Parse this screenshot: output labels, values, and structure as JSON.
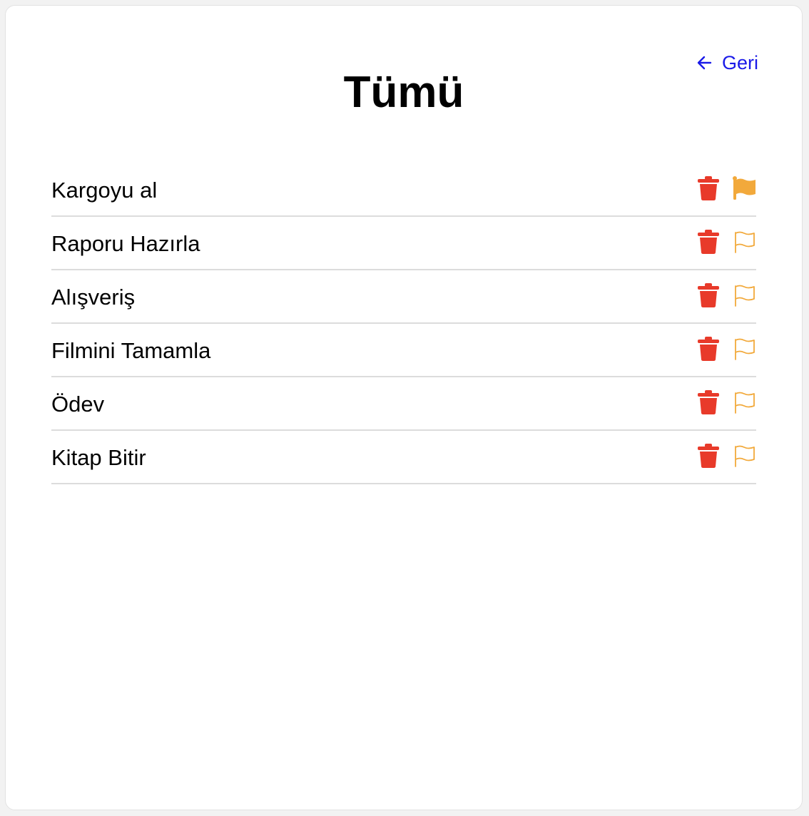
{
  "header": {
    "back_label": "Geri",
    "title": "Tümü"
  },
  "colors": {
    "link": "#1a1ae8",
    "trash": "#e83a2a",
    "flag": "#f2a93b"
  },
  "items": [
    {
      "label": "Kargoyu al",
      "flagged": true
    },
    {
      "label": "Raporu Hazırla",
      "flagged": false
    },
    {
      "label": "Alışveriş",
      "flagged": false
    },
    {
      "label": "Filmini Tamamla",
      "flagged": false
    },
    {
      "label": "Ödev",
      "flagged": false
    },
    {
      "label": "Kitap Bitir",
      "flagged": false
    }
  ]
}
